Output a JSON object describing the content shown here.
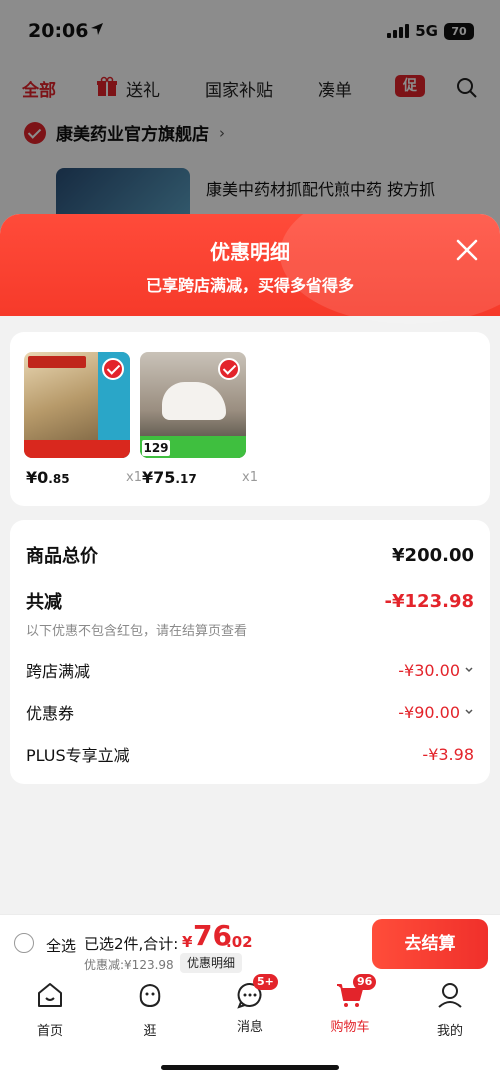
{
  "status_bar": {
    "time": "20:06",
    "network": "5G",
    "battery": "70"
  },
  "top_tabs": [
    {
      "label": "全部",
      "active": true
    },
    {
      "label": "送礼",
      "active": false
    },
    {
      "label": "国家补贴",
      "active": false
    },
    {
      "label": "凑单",
      "active": false
    }
  ],
  "promo_badge": "促",
  "store": {
    "name": "康美药业官方旗舰店",
    "arrow": "›"
  },
  "bg_product": {
    "title": "康美中药材抓配代煎中药 按方抓"
  },
  "sheet": {
    "title": "优惠明细",
    "subtitle": "已享跨店满减，买得多省得多"
  },
  "products": [
    {
      "currency": "¥",
      "price_int": "0",
      "price_dec": ".85",
      "qty": "x1"
    },
    {
      "currency": "¥",
      "price_int": "75",
      "price_dec": ".17",
      "qty": "x1",
      "tag": "129"
    }
  ],
  "summary": {
    "total_label": "商品总价",
    "total_value": "¥200.00",
    "reduce_label": "共减",
    "reduce_value": "-¥123.98",
    "hint": "以下优惠不包含红包，请在结算页查看",
    "items": [
      {
        "label": "跨店满减",
        "value": "-¥30.00"
      },
      {
        "label": "优惠券",
        "value": "-¥90.00"
      },
      {
        "label": "PLUS专享立减",
        "value": "-¥3.98"
      }
    ]
  },
  "checkout": {
    "select_all": "全选",
    "selected": "已选2件,合计:",
    "currency": "¥",
    "total_int": "76",
    "total_dec": ".02",
    "discount": "优惠减:¥123.98",
    "detail": "优惠明细",
    "button": "去结算"
  },
  "nav": [
    {
      "label": "首页",
      "icon": "home-icon"
    },
    {
      "label": "逛",
      "icon": "browse-icon"
    },
    {
      "label": "消息",
      "icon": "message-icon",
      "badge": "5+"
    },
    {
      "label": "购物车",
      "icon": "cart-icon",
      "badge": "96",
      "active": true
    },
    {
      "label": "我的",
      "icon": "profile-icon"
    }
  ],
  "colors": {
    "accent": "#e3242b",
    "header": "#f63a2a"
  }
}
